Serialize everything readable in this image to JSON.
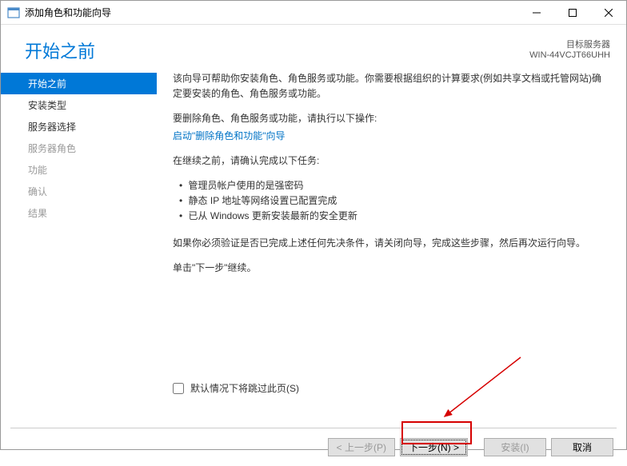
{
  "titlebar": {
    "title": "添加角色和功能向导"
  },
  "header": {
    "title": "开始之前",
    "server_label": "目标服务器",
    "server_name": "WIN-44VCJT66UHH"
  },
  "sidebar": {
    "items": [
      {
        "label": "开始之前",
        "state": "active"
      },
      {
        "label": "安装类型",
        "state": "enabled"
      },
      {
        "label": "服务器选择",
        "state": "enabled"
      },
      {
        "label": "服务器角色",
        "state": "disabled"
      },
      {
        "label": "功能",
        "state": "disabled"
      },
      {
        "label": "确认",
        "state": "disabled"
      },
      {
        "label": "结果",
        "state": "disabled"
      }
    ]
  },
  "main": {
    "intro": "该向导可帮助你安装角色、角色服务或功能。你需要根据组织的计算要求(例如共享文档或托管网站)确定要安装的角色、角色服务或功能。",
    "remove_line": "要删除角色、角色服务或功能，请执行以下操作:",
    "remove_link": "启动\"删除角色和功能\"向导",
    "before_continue": "在继续之前，请确认完成以下任务:",
    "tasks": [
      "管理员帐户使用的是强密码",
      "静态 IP 地址等网络设置已配置完成",
      "已从 Windows 更新安装最新的安全更新"
    ],
    "verify_line": "如果你必须验证是否已完成上述任何先决条件，请关闭向导，完成这些步骤，然后再次运行向导。",
    "click_next": "单击\"下一步\"继续。",
    "skip_label": "默认情况下将跳过此页(S)"
  },
  "footer": {
    "prev": "< 上一步(P)",
    "next": "下一步(N) >",
    "install": "安装(I)",
    "cancel": "取消"
  }
}
